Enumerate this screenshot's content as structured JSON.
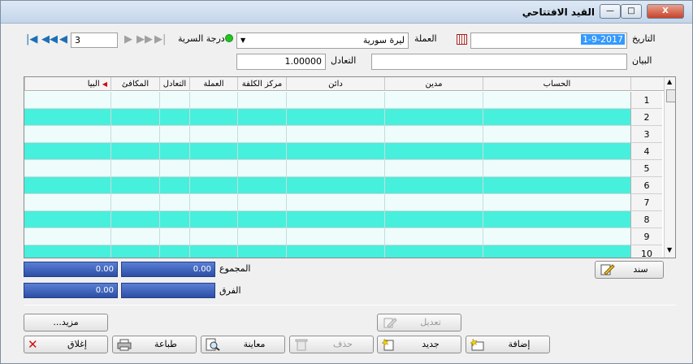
{
  "window": {
    "title": "القيد الافتتاحي",
    "minimize_label": "—",
    "maximize_label": "□",
    "close_label": "X"
  },
  "header": {
    "date_label": "التاريخ",
    "date_value": "1-9-2017",
    "currency_label": "العملة",
    "currency_value": "ليرة سورية",
    "exchange_label": "التعادل",
    "exchange_value": "1.00000",
    "statement_label": "البيان",
    "statement_value": "",
    "confidentiality_label": "درجة السرية",
    "record_number": "3"
  },
  "grid": {
    "columns": [
      "الحساب",
      "مدين",
      "دائن",
      "مركز الكلفة",
      "العملة",
      "التعادل",
      "المكافئ",
      "البيا"
    ],
    "row_numbers": [
      "1",
      "2",
      "3",
      "4",
      "5",
      "6",
      "7",
      "8",
      "9",
      "10"
    ]
  },
  "totals": {
    "sum_label": "المجموع",
    "diff_label": "الفرق",
    "sum_debit": "0.00",
    "sum_credit": "0.00",
    "diff_debit": "",
    "diff_credit": "0.00"
  },
  "buttons": {
    "voucher": "سند",
    "more": "مزيد...",
    "edit": "تعديل",
    "add": "إضافة",
    "new": "جديد",
    "delete": "حذف",
    "preview": "معاينة",
    "print": "طباعة",
    "close": "إغلاق"
  },
  "colors": {
    "row_alt": "#46f0dc",
    "sum_box": "#3a5cc0",
    "nav_blue": "#1e6fb5",
    "status_green": "#22c322"
  }
}
